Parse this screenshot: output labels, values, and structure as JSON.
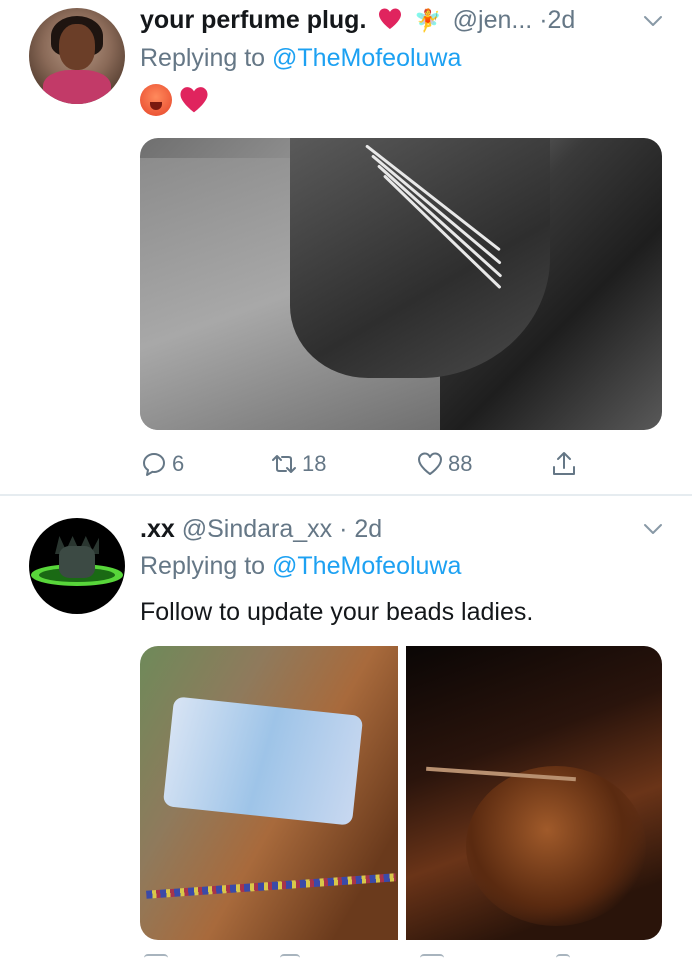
{
  "tweets": [
    {
      "display_name": "your perfume plug.",
      "handle": "@jen...",
      "separator": "·",
      "time": "2d",
      "replying_prefix": "Replying to ",
      "replying_to": "@TheMofeoluwa",
      "icons": {
        "name_emojis": [
          "red-heart-emoji",
          "fairy-emoji"
        ],
        "body_emojis": [
          "hot-face-emoji",
          "red-heart-emoji"
        ]
      },
      "media": [
        "black-and-white photo of waist beads"
      ],
      "counts": {
        "replies": "6",
        "retweets": "18",
        "likes": "88"
      }
    },
    {
      "display_name": ".xx",
      "handle": "@Sindara_xx",
      "separator": "·",
      "time": "2d",
      "replying_prefix": "Replying to ",
      "replying_to": "@TheMofeoluwa",
      "text": "Follow to update your beads ladies."
    }
  ],
  "colors": {
    "link": "#1da1f2",
    "muted": "#657786",
    "text": "#14171a",
    "heart": "#e0245e",
    "divider": "#e6ecf0"
  }
}
